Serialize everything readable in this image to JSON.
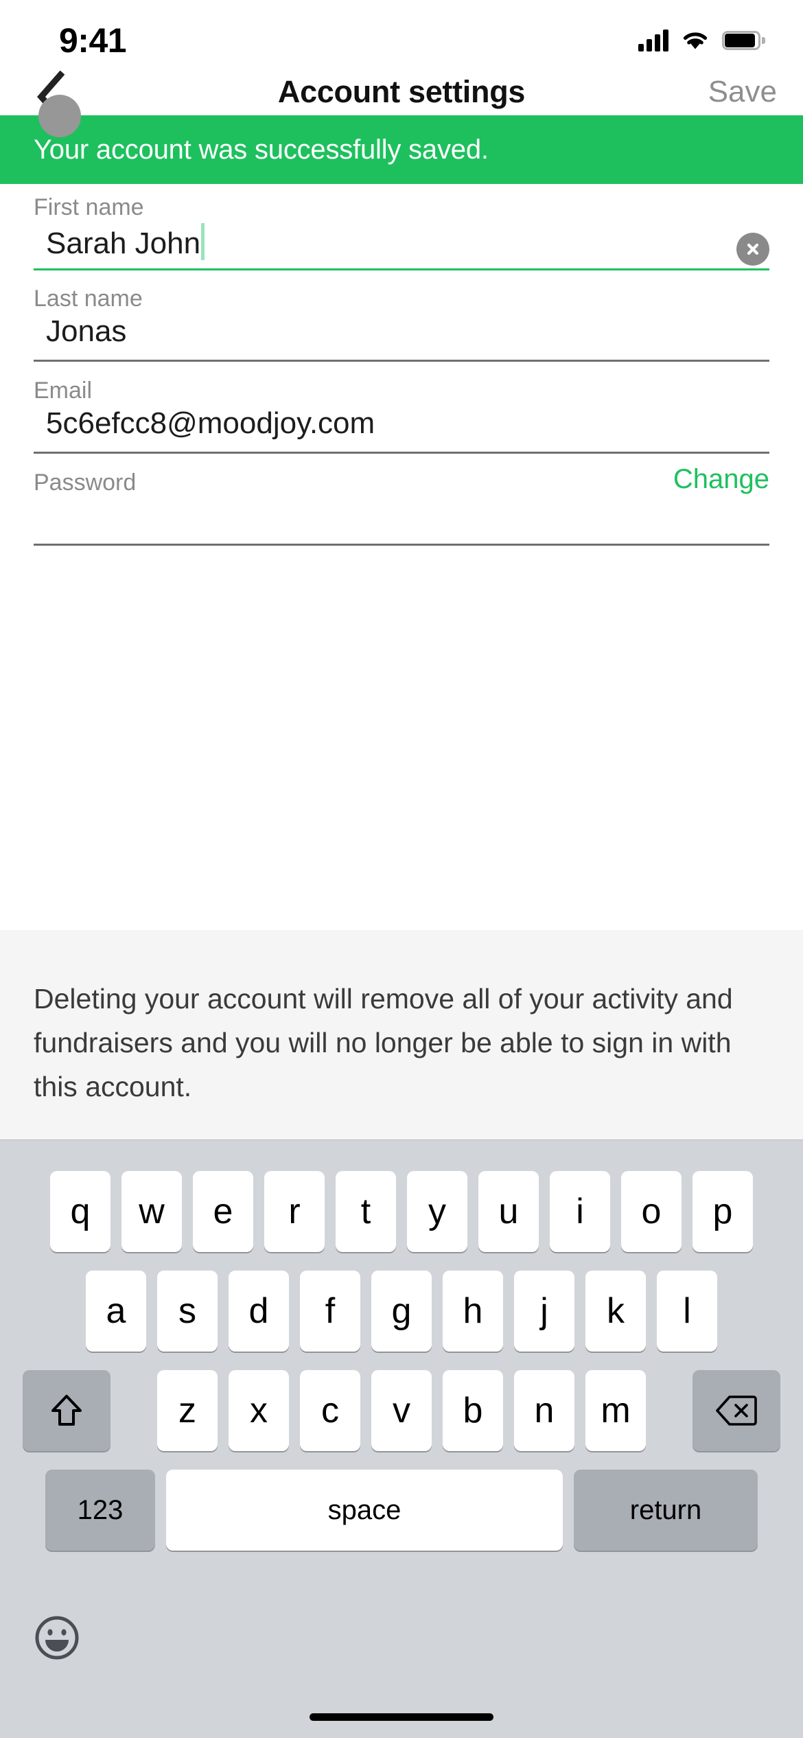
{
  "status_bar": {
    "time": "9:41",
    "signal_icon": "cellular-signal-icon",
    "wifi_icon": "wifi-icon",
    "battery_icon": "battery-icon"
  },
  "nav": {
    "back_icon": "chevron-left-icon",
    "title": "Account settings",
    "save_label": "Save"
  },
  "banner": {
    "message": "Your account was successfully saved.",
    "color": "#1ec05e"
  },
  "form": {
    "first_name": {
      "label": "First name",
      "value": "Sarah John",
      "clear_icon": "clear-circle-icon",
      "focused": true
    },
    "last_name": {
      "label": "Last name",
      "value": "Jonas"
    },
    "email": {
      "label": "Email",
      "value": "5c6efcc8@moodjoy.com"
    },
    "password": {
      "label": "Password",
      "action_label": "Change",
      "value": ""
    }
  },
  "delete_section": {
    "description": "Deleting your account will remove all of your activity and fundraisers and you will no longer be able to sign in with this account."
  },
  "keyboard": {
    "row1": [
      "q",
      "w",
      "e",
      "r",
      "t",
      "y",
      "u",
      "i",
      "o",
      "p"
    ],
    "row2": [
      "a",
      "s",
      "d",
      "f",
      "g",
      "h",
      "j",
      "k",
      "l"
    ],
    "row3": [
      "z",
      "x",
      "c",
      "v",
      "b",
      "n",
      "m"
    ],
    "shift_icon": "shift-arrow-icon",
    "backspace_icon": "backspace-delete-icon",
    "numeric_label": "123",
    "space_label": "space",
    "return_label": "return",
    "emoji_icon": "emoji-smiley-icon"
  },
  "colors": {
    "accent_green": "#1ec05e",
    "keyboard_bg": "#d1d4d9",
    "key_gray": "#a9adb4",
    "section_bg": "#f5f5f5"
  }
}
